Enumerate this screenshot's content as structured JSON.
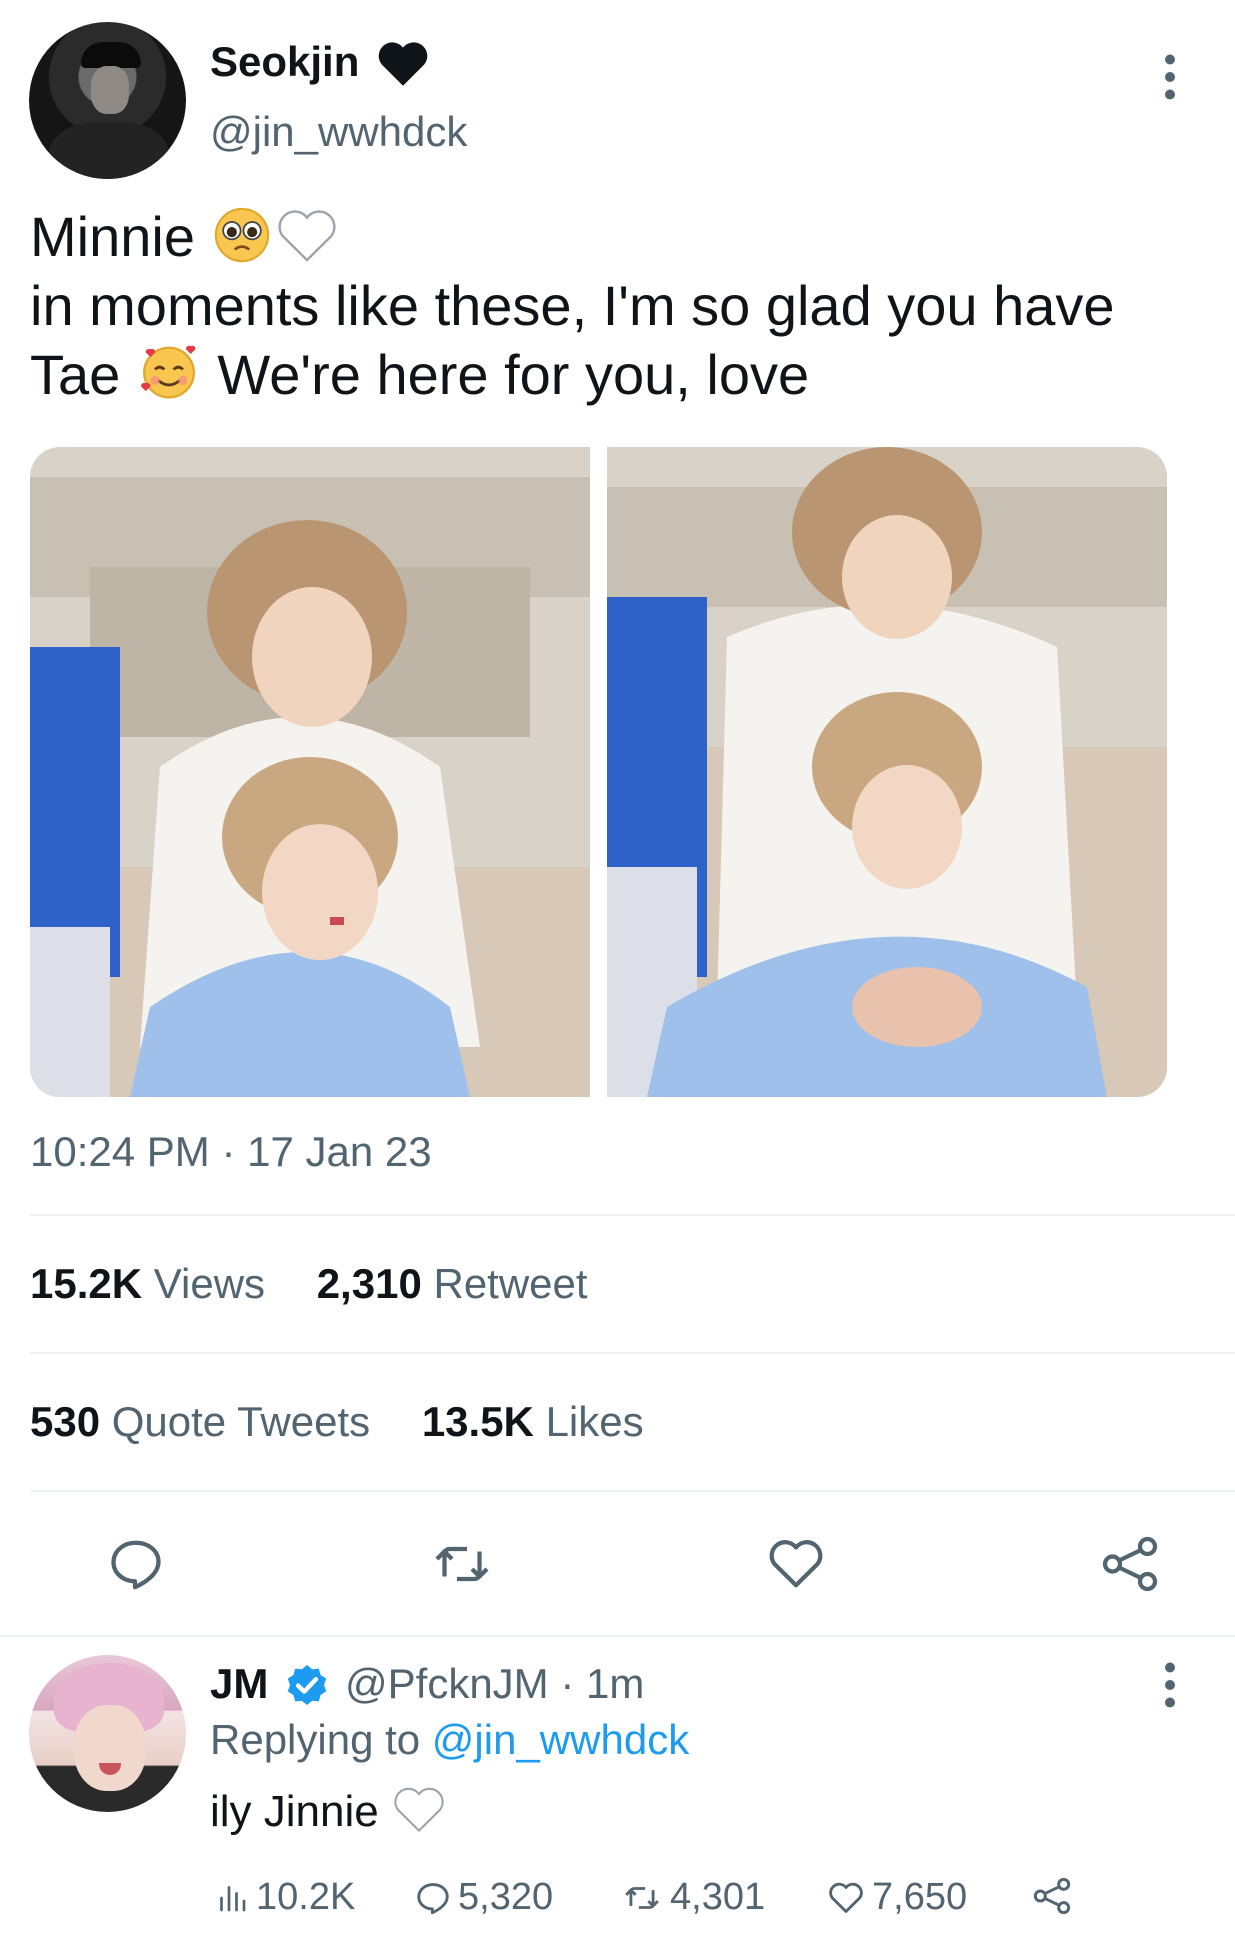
{
  "tweet": {
    "author_name": "Seokjin",
    "author_handle": "@jin_wwhdck",
    "text_line1": "Minnie",
    "text_line2": "in moments like these, I'm so glad you have",
    "text_line3a": "Tae",
    "text_line3b": "We're here for you, love",
    "emoji_line1": [
      "pleading-face",
      "white-heart"
    ],
    "emoji_line3": "smiling-face-with-hearts",
    "timestamp": "10:24 PM · 17 Jan 23",
    "stats": {
      "views_count": "15.2K",
      "views_label": "Views",
      "retweets_count": "2,310",
      "retweets_label": "Retweet",
      "quotes_count": "530",
      "quotes_label": "Quote Tweets",
      "likes_count": "13.5K",
      "likes_label": "Likes"
    },
    "actions": [
      "reply-icon",
      "retweet-icon",
      "like-icon",
      "share-icon"
    ]
  },
  "reply": {
    "author_name": "JM",
    "author_handle_time": "@PfcknJM · 1m",
    "replying_prefix": "Replying to",
    "replying_handle": "@jin_wwhdck",
    "text": "ily Jinnie",
    "emoji": "white-heart",
    "views": "10.2K",
    "replies": "5,320",
    "retweets": "4,301",
    "likes": "7,650"
  },
  "colors": {
    "text_primary": "#0f1419",
    "text_secondary": "#536471",
    "accent": "#1d9bf0",
    "divider": "#eff3f4"
  }
}
